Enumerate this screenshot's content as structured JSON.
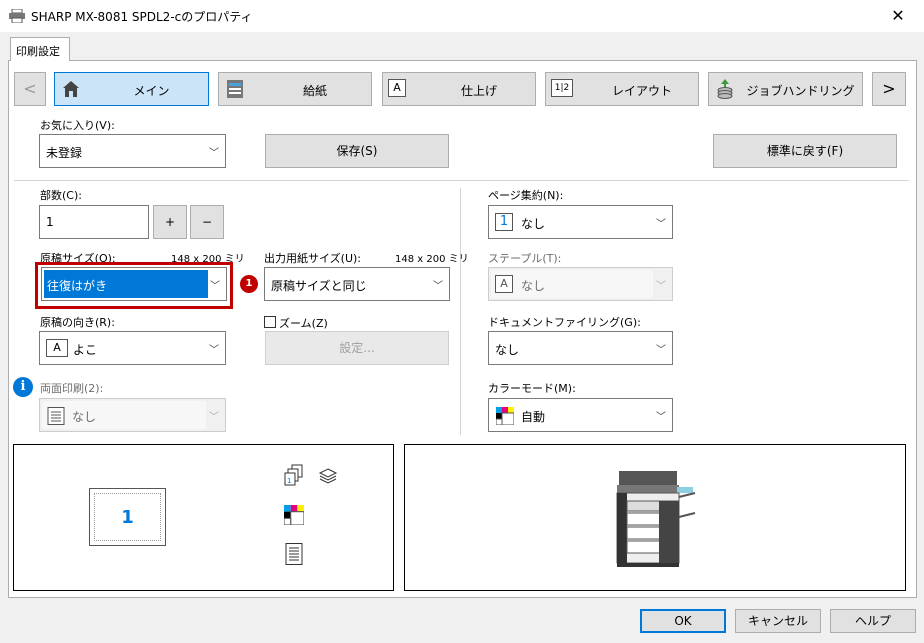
{
  "window": {
    "title": "SHARP MX-8081 SPDL2-cのプロパティ",
    "close_glyph": "✕"
  },
  "tab": {
    "label": "印刷設定"
  },
  "nav": {
    "prev_glyph": "<",
    "next_glyph": ">",
    "tabs": [
      {
        "label": "メイン",
        "icon": "home-icon",
        "active": true
      },
      {
        "label": "給紙",
        "icon": "printer-tray-icon"
      },
      {
        "label": "仕上げ",
        "icon": "finishing-icon",
        "glyph": "A"
      },
      {
        "label": "レイアウト",
        "icon": "layout-icon",
        "glyph": "1|2"
      },
      {
        "label": "ジョブハンドリング",
        "icon": "job-handling-icon"
      }
    ]
  },
  "favorites": {
    "label": "お気に入り(V):",
    "value": "未登録",
    "save_label": "保存(S)",
    "reset_label": "標準に戻す(F)"
  },
  "copies": {
    "label": "部数(C):",
    "value": "1",
    "plus": "+",
    "minus": "−"
  },
  "original_size": {
    "label": "原稿サイズ(O):",
    "dims": "148 x 200 ミリ",
    "value": "往復はがき",
    "badge": "1"
  },
  "output_size": {
    "label": "出力用紙サイズ(U):",
    "dims": "148 x 200 ミリ",
    "value": "原稿サイズと同じ"
  },
  "orientation": {
    "label": "原稿の向き(R):",
    "value": "よこ",
    "glyph": "A"
  },
  "zoom": {
    "label": "ズーム(Z)",
    "settings_label": "設定..."
  },
  "duplex": {
    "label": "両面印刷(2):",
    "value": "なし",
    "info_glyph": "i"
  },
  "nup": {
    "label": "ページ集約(N):",
    "value": "なし",
    "glyph": "1"
  },
  "staple": {
    "label": "ステープル(T):",
    "value": "なし",
    "glyph": "A"
  },
  "doc_filing": {
    "label": "ドキュメントファイリング(G):",
    "value": "なし"
  },
  "color_mode": {
    "label": "カラーモード(M):",
    "value": "自動"
  },
  "preview": {
    "page_number": "1"
  },
  "footer": {
    "ok": "OK",
    "cancel": "キャンセル",
    "help": "ヘルプ"
  },
  "colors": {
    "accent": "#0078d7",
    "highlight_border": "#c00000",
    "badge": "#c00000"
  }
}
